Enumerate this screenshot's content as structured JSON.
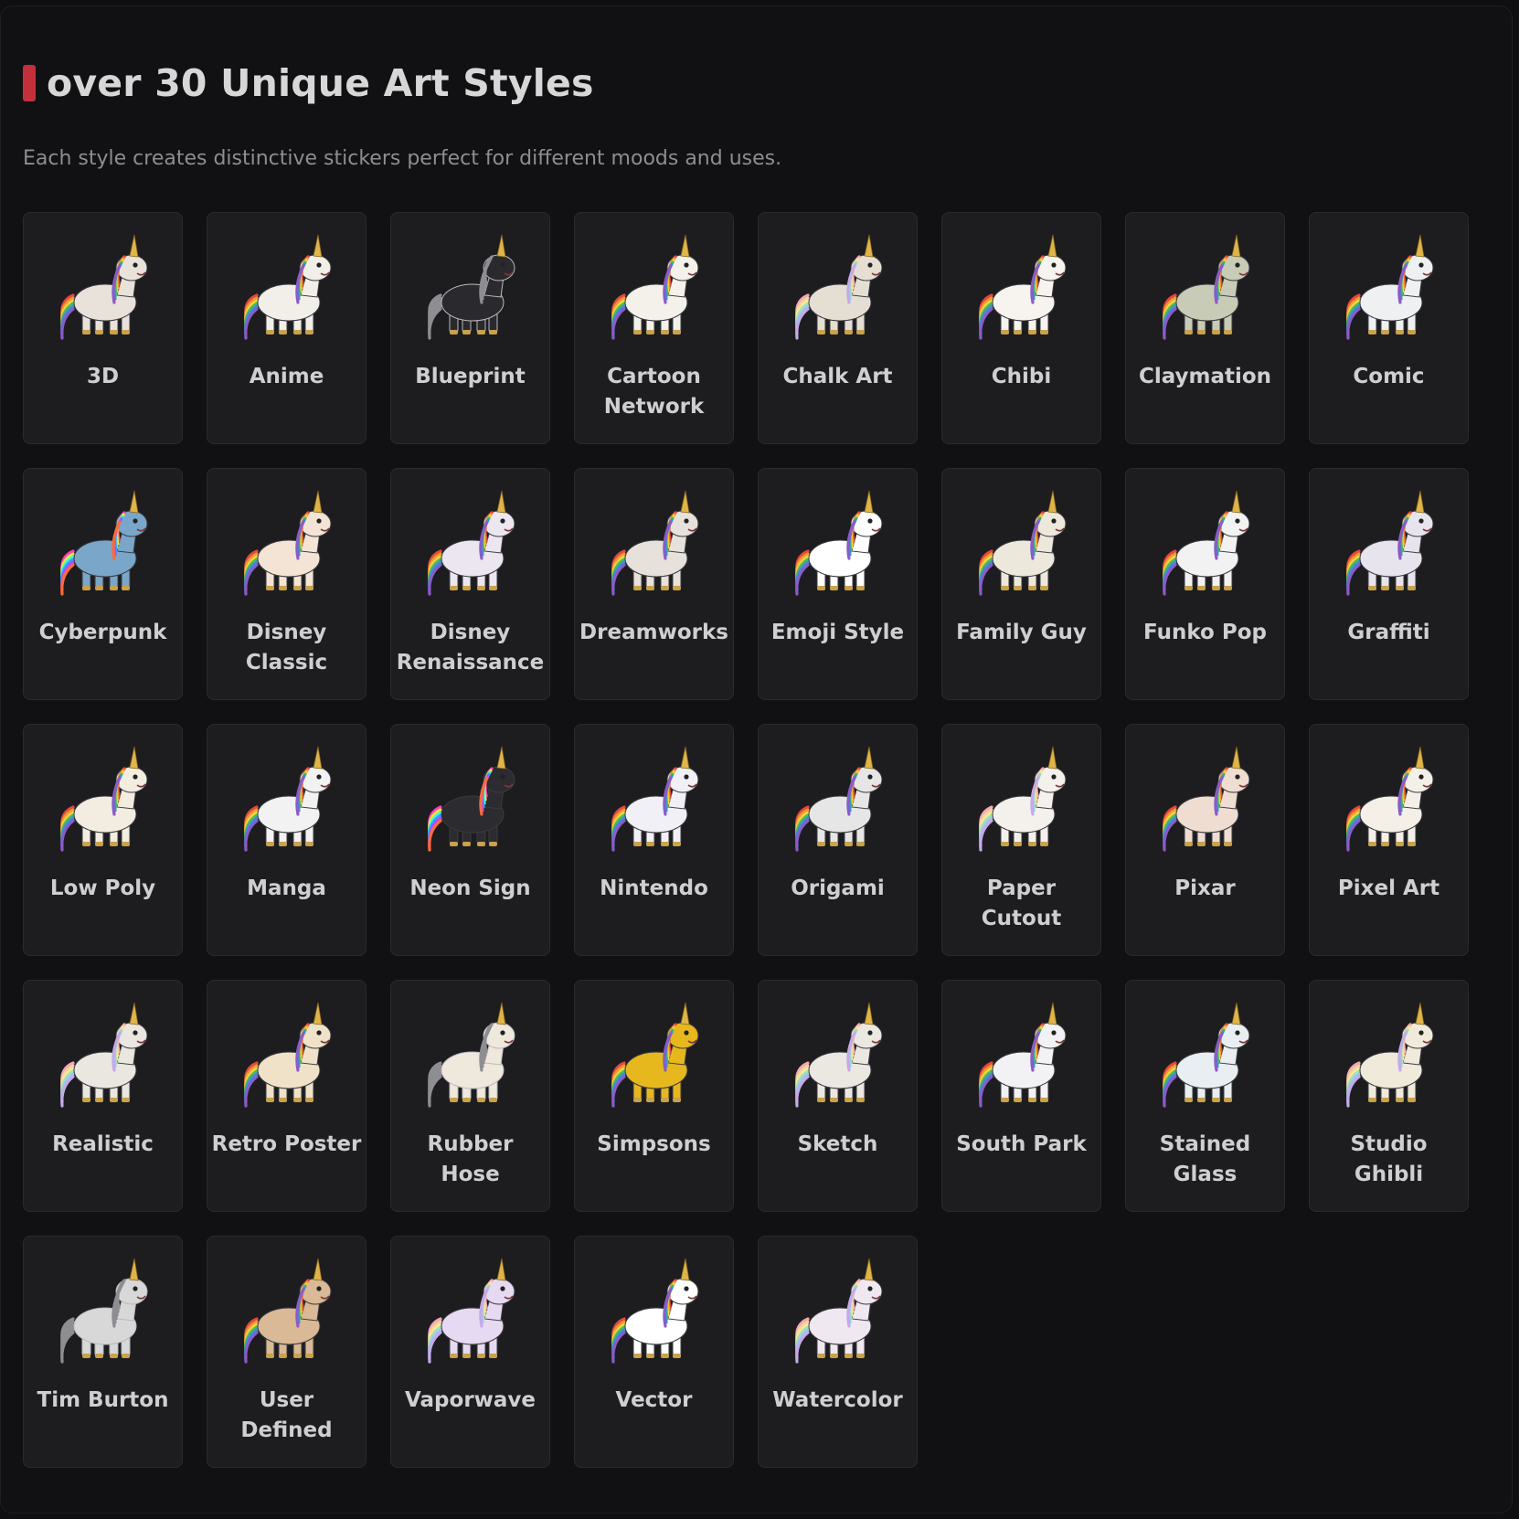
{
  "section": {
    "title": "over 30 Unique Art Styles",
    "subtitle": "Each style creates distinctive stickers perfect for different moods and uses."
  },
  "styles": [
    {
      "label": "3D",
      "icon": "unicorn-3d-icon",
      "body": "#e8e2da",
      "mane": "rainbow"
    },
    {
      "label": "Anime",
      "icon": "unicorn-anime-icon",
      "body": "#f2efe8",
      "mane": "rainbow"
    },
    {
      "label": "Blueprint",
      "icon": "unicorn-blueprint-icon",
      "body": "#2a2a2e",
      "mane": "outline"
    },
    {
      "label": "Cartoon Network",
      "icon": "unicorn-cartoon-network-icon",
      "body": "#f4f1ea",
      "mane": "rainbow"
    },
    {
      "label": "Chalk Art",
      "icon": "unicorn-chalk-art-icon",
      "body": "#e5ded2",
      "mane": "pastel"
    },
    {
      "label": "Chibi",
      "icon": "unicorn-chibi-icon",
      "body": "#f7f3ee",
      "mane": "rainbow"
    },
    {
      "label": "Claymation",
      "icon": "unicorn-claymation-icon",
      "body": "#c8ccb6",
      "mane": "rainbow"
    },
    {
      "label": "Comic",
      "icon": "unicorn-comic-icon",
      "body": "#eef0f2",
      "mane": "rainbow"
    },
    {
      "label": "Cyberpunk",
      "icon": "unicorn-cyberpunk-icon",
      "body": "#7aa7c9",
      "mane": "neon"
    },
    {
      "label": "Disney Classic",
      "icon": "unicorn-disney-classic-icon",
      "body": "#f3e4d6",
      "mane": "rainbow"
    },
    {
      "label": "Disney Renaissance",
      "icon": "unicorn-disney-renaissance-icon",
      "body": "#ece6f0",
      "mane": "rainbow"
    },
    {
      "label": "Dreamworks",
      "icon": "unicorn-dreamworks-icon",
      "body": "#e6e1da",
      "mane": "rainbow"
    },
    {
      "label": "Emoji Style",
      "icon": "unicorn-emoji-style-icon",
      "body": "#ffffff",
      "mane": "rainbow"
    },
    {
      "label": "Family Guy",
      "icon": "unicorn-family-guy-icon",
      "body": "#ece8dc",
      "mane": "rainbow"
    },
    {
      "label": "Funko Pop",
      "icon": "unicorn-funko-pop-icon",
      "body": "#f2f2f2",
      "mane": "rainbow"
    },
    {
      "label": "Graffiti",
      "icon": "unicorn-graffiti-icon",
      "body": "#e8e4ee",
      "mane": "rainbow"
    },
    {
      "label": "Low Poly",
      "icon": "unicorn-low-poly-icon",
      "body": "#f3ece0",
      "mane": "rainbow"
    },
    {
      "label": "Manga",
      "icon": "unicorn-manga-icon",
      "body": "#f2f2f2",
      "mane": "rainbow"
    },
    {
      "label": "Neon Sign",
      "icon": "unicorn-neon-sign-icon",
      "body": "#2b2b30",
      "mane": "neon"
    },
    {
      "label": "Nintendo",
      "icon": "unicorn-nintendo-icon",
      "body": "#f0f0f6",
      "mane": "rainbow"
    },
    {
      "label": "Origami",
      "icon": "unicorn-origami-icon",
      "body": "#e6e6e6",
      "mane": "rainbow"
    },
    {
      "label": "Paper Cutout",
      "icon": "unicorn-paper-cutout-icon",
      "body": "#f4f1ec",
      "mane": "pastel"
    },
    {
      "label": "Pixar",
      "icon": "unicorn-pixar-icon",
      "body": "#efddd2",
      "mane": "rainbow"
    },
    {
      "label": "Pixel Art",
      "icon": "unicorn-pixel-art-icon",
      "body": "#f4f0e8",
      "mane": "rainbow"
    },
    {
      "label": "Realistic",
      "icon": "unicorn-realistic-icon",
      "body": "#eae6e0",
      "mane": "pastel"
    },
    {
      "label": "Retro Poster",
      "icon": "unicorn-retro-poster-icon",
      "body": "#efe2c8",
      "mane": "rainbow"
    },
    {
      "label": "Rubber Hose",
      "icon": "unicorn-rubber-hose-icon",
      "body": "#efe8dc",
      "mane": "outline"
    },
    {
      "label": "Simpsons",
      "icon": "unicorn-simpsons-icon",
      "body": "#e6b81e",
      "mane": "rainbow"
    },
    {
      "label": "Sketch",
      "icon": "unicorn-sketch-icon",
      "body": "#ebe8e2",
      "mane": "pastel"
    },
    {
      "label": "South Park",
      "icon": "unicorn-south-park-icon",
      "body": "#f2f2f4",
      "mane": "rainbow"
    },
    {
      "label": "Stained Glass",
      "icon": "unicorn-stained-glass-icon",
      "body": "#e8eef2",
      "mane": "rainbow"
    },
    {
      "label": "Studio Ghibli",
      "icon": "unicorn-studio-ghibli-icon",
      "body": "#f0eadb",
      "mane": "pastel"
    },
    {
      "label": "Tim Burton",
      "icon": "unicorn-tim-burton-icon",
      "body": "#d8d8d8",
      "mane": "outline"
    },
    {
      "label": "User Defined",
      "icon": "unicorn-user-defined-icon",
      "body": "#d9b996",
      "mane": "rainbow"
    },
    {
      "label": "Vaporwave",
      "icon": "unicorn-vaporwave-icon",
      "body": "#e6d9f2",
      "mane": "pastel"
    },
    {
      "label": "Vector",
      "icon": "unicorn-vector-icon",
      "body": "#ffffff",
      "mane": "rainbow"
    },
    {
      "label": "Watercolor",
      "icon": "unicorn-watercolor-icon",
      "body": "#efe8f0",
      "mane": "pastel"
    }
  ],
  "colors": {
    "accent": "#c4303a",
    "card_bg": "#1d1d20",
    "page_bg": "#111113",
    "text": "#cfcfd2",
    "subtext": "#8d8d92"
  }
}
